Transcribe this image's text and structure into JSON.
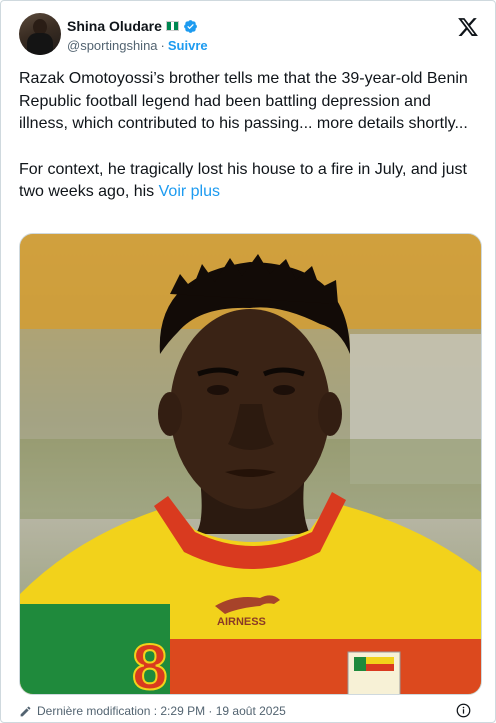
{
  "user": {
    "display_name": "Shina Oludare",
    "handle": "@sportingshina",
    "separator": "·",
    "follow_label": "Suivre",
    "flag_colors": [
      "#008751",
      "#ffffff",
      "#008751"
    ]
  },
  "tweet": {
    "paragraph1": "Razak Omotoyossi’s brother tells me that the 39-year-old Benin Republic football legend had been battling depression and illness, which contributed to his passing... more details shortly...",
    "paragraph2": "For context, he tragically lost his house to a fire in July, and just two weeks ago, his ",
    "more_label": "Voir plus"
  },
  "media": {
    "jersey_brand": "AIRNESS",
    "jersey_number": "8"
  },
  "footer": {
    "edit_text": "Dernière modification : 2:29 PM · 19 août 2025"
  },
  "colors": {
    "accent": "#1d9bf0",
    "text": "#0f1419",
    "secondary": "#536471",
    "jersey_yellow": "#f2d21b",
    "jersey_red": "#d93a1f",
    "jersey_green": "#1f8a3c"
  },
  "icons": {
    "verified": "verified-badge-icon",
    "logo": "x-logo-icon",
    "edit": "pencil-icon",
    "info": "info-icon"
  }
}
